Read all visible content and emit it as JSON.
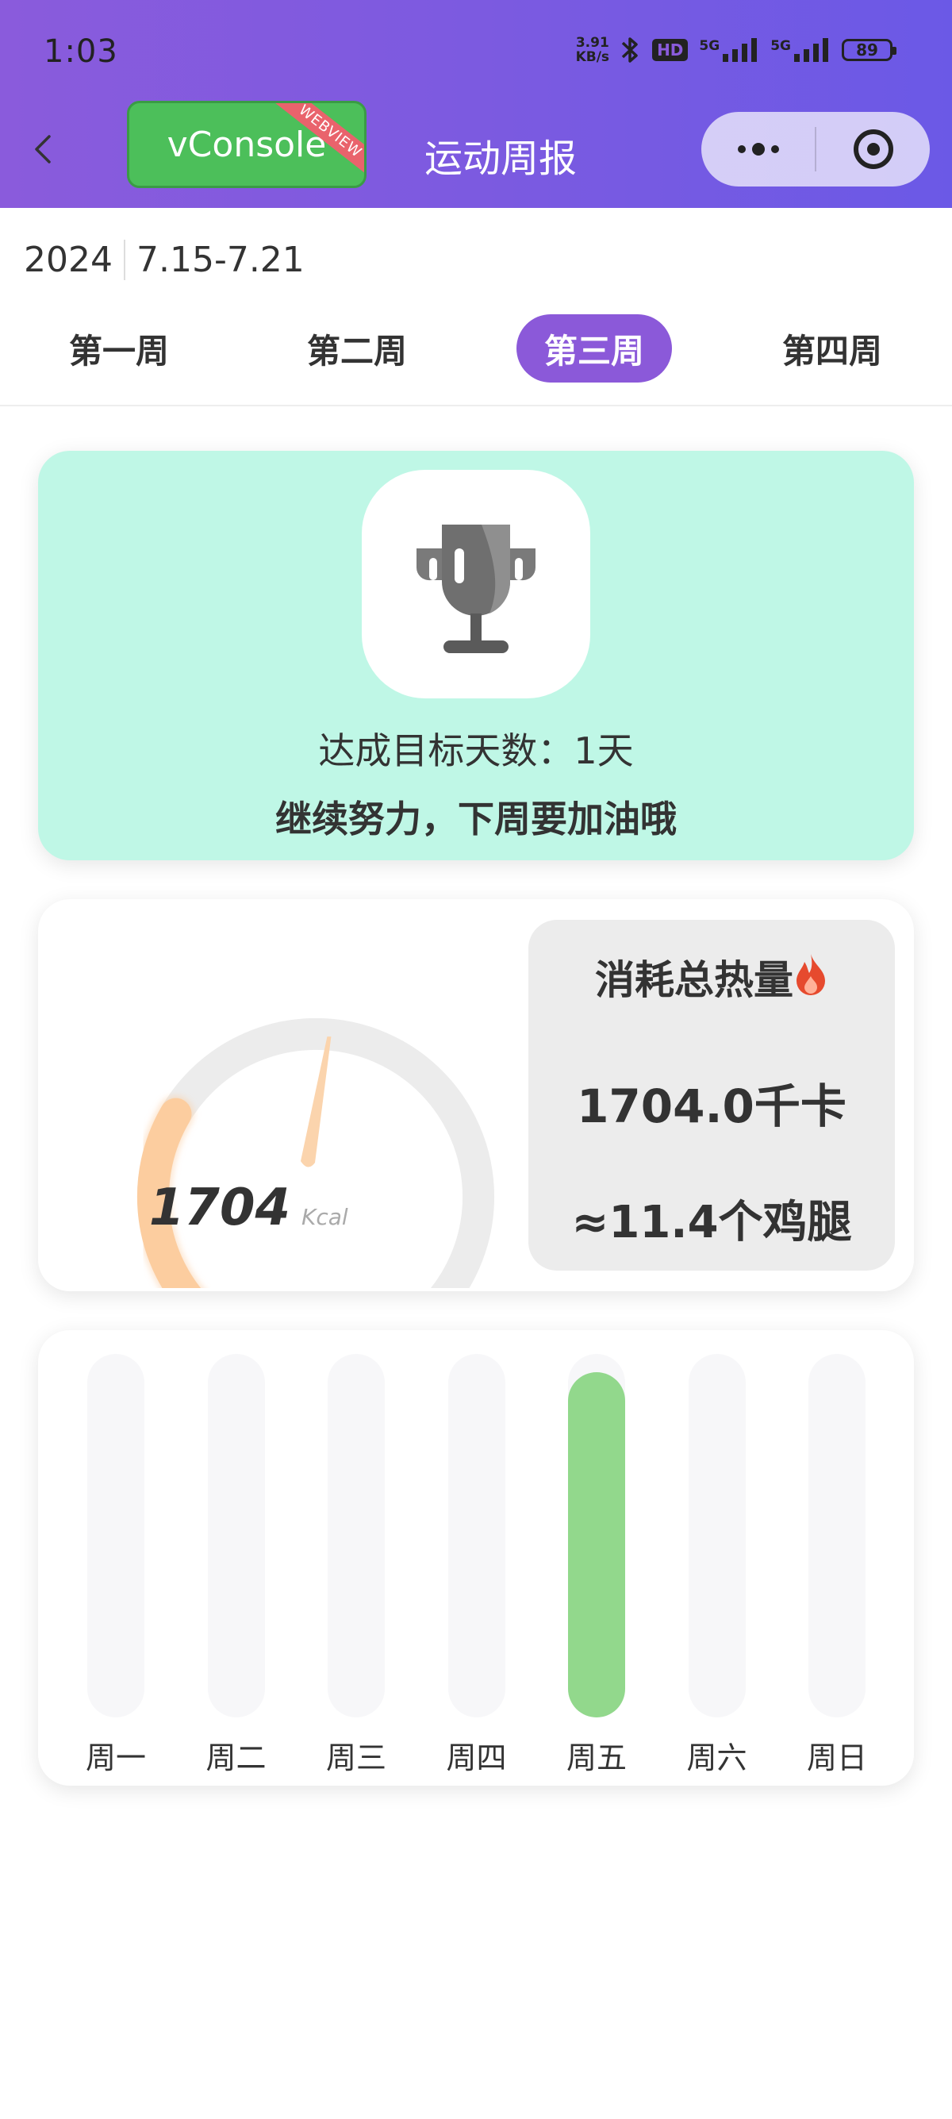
{
  "status_bar": {
    "time": "1:03",
    "net_speed_value": "3.91",
    "net_speed_unit": "KB/s",
    "hd_badge": "HD",
    "signal1_label": "5G",
    "signal2_label": "5G",
    "battery": "89"
  },
  "nav": {
    "title": "运动周报",
    "vconsole_label": "vConsole",
    "vconsole_ribbon": "WEBVIEW"
  },
  "date": {
    "year": "2024",
    "range": "7.15-7.21"
  },
  "weeks": {
    "items": [
      {
        "label": "第一周"
      },
      {
        "label": "第二周"
      },
      {
        "label": "第三周"
      },
      {
        "label": "第四周"
      }
    ],
    "active_index": 2
  },
  "goal_card": {
    "days_text": "达成目标天数：1天",
    "message": "继续努力，下周要加油哦"
  },
  "calorie_card": {
    "gauge_value": "1704",
    "gauge_unit": "Kcal",
    "gauge_fraction": 0.28,
    "title": "消耗总热量",
    "total": "1704.0千卡",
    "equivalent": "≈11.4个鸡腿",
    "colors": {
      "accent": "#fccd9f",
      "flame": "#e64a2e"
    }
  },
  "weekly_chart": {
    "days": [
      {
        "label": "周一",
        "fraction": 0
      },
      {
        "label": "周二",
        "fraction": 0
      },
      {
        "label": "周三",
        "fraction": 0
      },
      {
        "label": "周四",
        "fraction": 0
      },
      {
        "label": "周五",
        "fraction": 0.95
      },
      {
        "label": "周六",
        "fraction": 0
      },
      {
        "label": "周日",
        "fraction": 0
      }
    ],
    "colors": {
      "fill": "#92d88c",
      "track": "#f7f7f9"
    }
  },
  "colors": {
    "header_start": "#8a5bdc",
    "header_end": "#6b59e6",
    "active_tab": "#8b59d9",
    "goal_card_bg": "#bff7e6",
    "vconsole_green": "#4cbf5a"
  }
}
